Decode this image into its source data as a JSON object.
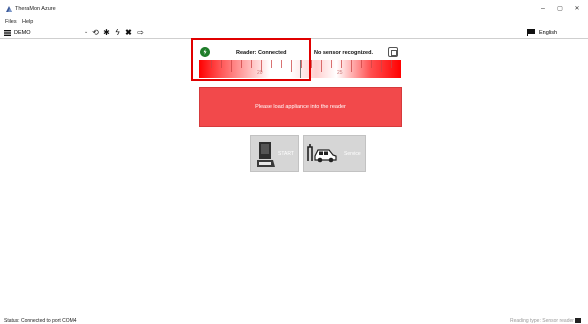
{
  "window": {
    "title": "TheraMon Azure",
    "controls": {
      "minimize": "–",
      "maximize": "▢",
      "close": "✕"
    }
  },
  "menu": [
    {
      "label": "Files"
    },
    {
      "label": "Help"
    }
  ],
  "toolbar": {
    "device_select": "DEMO",
    "language": "English",
    "icons": [
      "refresh-icon",
      "bluetooth-icon",
      "flash-icon",
      "delete-icon",
      "export-icon"
    ]
  },
  "reader": {
    "reader_status": "Reader: Connected",
    "sensor_status": "No sensor recognized.",
    "gauge_labels": [
      "20",
      "25"
    ]
  },
  "message": "Please load appliance into the reader",
  "buttons": {
    "start": "START",
    "service": "Service"
  },
  "statusbar": {
    "text": "Status: Connected to port COM4",
    "right_text": "Reading type: Sensor reader"
  },
  "colors": {
    "alert_red": "#f2494b",
    "highlight_red": "#e00000",
    "connected_green": "#1f7d2a",
    "button_gray": "#d6d6d6"
  }
}
